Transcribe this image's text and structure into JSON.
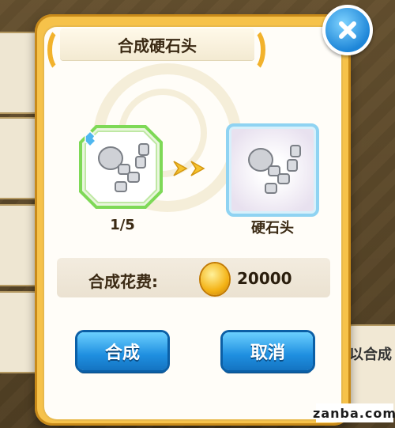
{
  "dialog": {
    "title": "合成硬石头",
    "close_icon": "close-icon"
  },
  "materials": {
    "source_count": "1/5",
    "result_name": "硬石头",
    "source_icon": "stone-material-icon",
    "result_icon": "stone-material-icon"
  },
  "cost": {
    "label": "合成花费:",
    "coin_icon": "gold-coin-icon",
    "value": "20000"
  },
  "buttons": {
    "synthesize": "合成",
    "cancel": "取消"
  },
  "background": {
    "partial_text": "以合成"
  },
  "watermark": "zanba.com",
  "colors": {
    "accent_blue": "#1f8fe0",
    "frame_gold": "#f6c24a",
    "source_border": "#7ed957",
    "result_border": "#8fd3f2"
  }
}
